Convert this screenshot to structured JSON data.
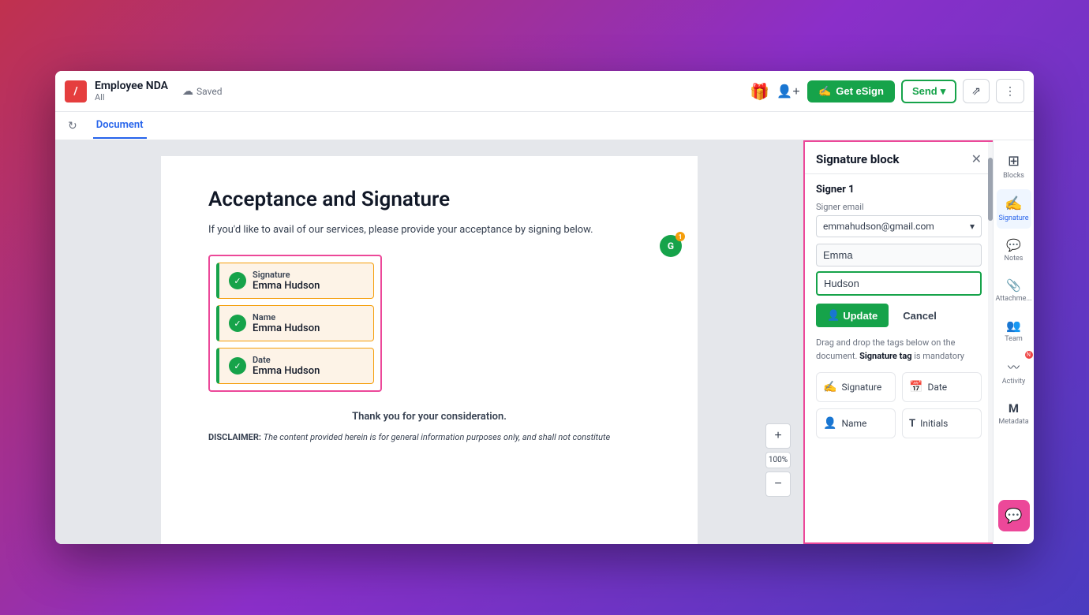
{
  "header": {
    "logo_text": "/",
    "doc_title": "Employee NDA",
    "breadcrumb": "All",
    "saved_label": "Saved",
    "get_esign_label": "Get eSign",
    "send_label": "Send",
    "tabs": [
      {
        "id": "document",
        "label": "Document",
        "active": true
      }
    ]
  },
  "toolbar": {
    "refresh_title": "Refresh"
  },
  "document": {
    "heading": "Acceptance and Signature",
    "intro": "If you'd like to avail of our services, please provide your acceptance by signing below.",
    "signature_block": {
      "signature_label": "Signature",
      "signature_name": "Emma Hudson",
      "name_label": "Name",
      "name_value": "Emma Hudson",
      "date_label": "Date",
      "date_value": "Emma Hudson"
    },
    "footer_text": "Thank you for your consideration.",
    "disclaimer": "DISCLAIMER: The content provided herein is for general information purposes only, and shall not constitute"
  },
  "zoom": {
    "percentage": "100%",
    "plus_label": "+",
    "minus_label": "−"
  },
  "sig_panel": {
    "title": "Signature block",
    "signer_label": "Signer 1",
    "email_field_label": "Signer email",
    "email_value": "emmahudson@gmail.com",
    "first_name_value": "Emma",
    "last_name_value": "Hudson",
    "update_label": "Update",
    "cancel_label": "Cancel",
    "drag_hint_part1": "Drag and drop the tags below on the document.",
    "drag_hint_bold": "Signature tag",
    "drag_hint_part2": "is mandatory",
    "tags": [
      {
        "id": "signature",
        "label": "Signature",
        "icon": "✍"
      },
      {
        "id": "date",
        "label": "Date",
        "icon": "📅"
      },
      {
        "id": "name",
        "label": "Name",
        "icon": "👤"
      },
      {
        "id": "initials",
        "label": "Initials",
        "icon": "T"
      }
    ]
  },
  "right_sidebar": {
    "items": [
      {
        "id": "blocks",
        "label": "Blocks",
        "icon": "⊞",
        "active": false
      },
      {
        "id": "signature",
        "label": "Signature",
        "icon": "✍",
        "active": true
      },
      {
        "id": "notes",
        "label": "Notes",
        "icon": "💬",
        "active": false
      },
      {
        "id": "attachment",
        "label": "Attachme...",
        "icon": "📎",
        "active": false
      },
      {
        "id": "team",
        "label": "Team",
        "icon": "👥",
        "active": false
      },
      {
        "id": "activity",
        "label": "Activity",
        "icon": "〰",
        "active": false,
        "badge": "N"
      },
      {
        "id": "metadata",
        "label": "Metadata",
        "icon": "M",
        "active": false
      }
    ],
    "chat_icon": "💬"
  }
}
